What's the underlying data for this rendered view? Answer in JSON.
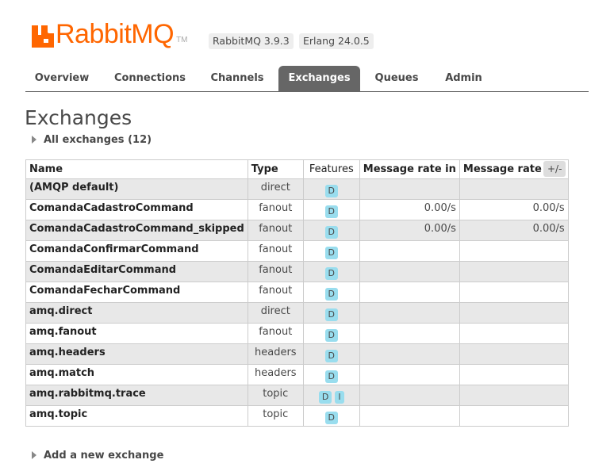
{
  "header": {
    "logo_text": "RabbitMQ",
    "logo_tm": "TM",
    "versions": [
      "RabbitMQ 3.9.3",
      "Erlang 24.0.5"
    ],
    "brand_color": "#ff6600"
  },
  "tabs": [
    {
      "label": "Overview",
      "active": false
    },
    {
      "label": "Connections",
      "active": false
    },
    {
      "label": "Channels",
      "active": false
    },
    {
      "label": "Exchanges",
      "active": true
    },
    {
      "label": "Queues",
      "active": false
    },
    {
      "label": "Admin",
      "active": false
    }
  ],
  "page": {
    "title": "Exchanges",
    "all_exchanges_label": "All exchanges (12)",
    "add_exchange_label": "Add a new exchange",
    "columns_toggle": "+/-"
  },
  "table": {
    "columns": [
      "Name",
      "Type",
      "Features",
      "Message rate in",
      "Message rate out"
    ],
    "rows": [
      {
        "name": "(AMQP default)",
        "type": "direct",
        "features": [
          "D"
        ],
        "rate_in": "",
        "rate_out": ""
      },
      {
        "name": "ComandaCadastroCommand",
        "type": "fanout",
        "features": [
          "D"
        ],
        "rate_in": "0.00/s",
        "rate_out": "0.00/s"
      },
      {
        "name": "ComandaCadastroCommand_skipped",
        "type": "fanout",
        "features": [
          "D"
        ],
        "rate_in": "0.00/s",
        "rate_out": "0.00/s"
      },
      {
        "name": "ComandaConfirmarCommand",
        "type": "fanout",
        "features": [
          "D"
        ],
        "rate_in": "",
        "rate_out": ""
      },
      {
        "name": "ComandaEditarCommand",
        "type": "fanout",
        "features": [
          "D"
        ],
        "rate_in": "",
        "rate_out": ""
      },
      {
        "name": "ComandaFecharCommand",
        "type": "fanout",
        "features": [
          "D"
        ],
        "rate_in": "",
        "rate_out": ""
      },
      {
        "name": "amq.direct",
        "type": "direct",
        "features": [
          "D"
        ],
        "rate_in": "",
        "rate_out": ""
      },
      {
        "name": "amq.fanout",
        "type": "fanout",
        "features": [
          "D"
        ],
        "rate_in": "",
        "rate_out": ""
      },
      {
        "name": "amq.headers",
        "type": "headers",
        "features": [
          "D"
        ],
        "rate_in": "",
        "rate_out": ""
      },
      {
        "name": "amq.match",
        "type": "headers",
        "features": [
          "D"
        ],
        "rate_in": "",
        "rate_out": ""
      },
      {
        "name": "amq.rabbitmq.trace",
        "type": "topic",
        "features": [
          "D",
          "I"
        ],
        "rate_in": "",
        "rate_out": ""
      },
      {
        "name": "amq.topic",
        "type": "topic",
        "features": [
          "D"
        ],
        "rate_in": "",
        "rate_out": ""
      }
    ]
  }
}
